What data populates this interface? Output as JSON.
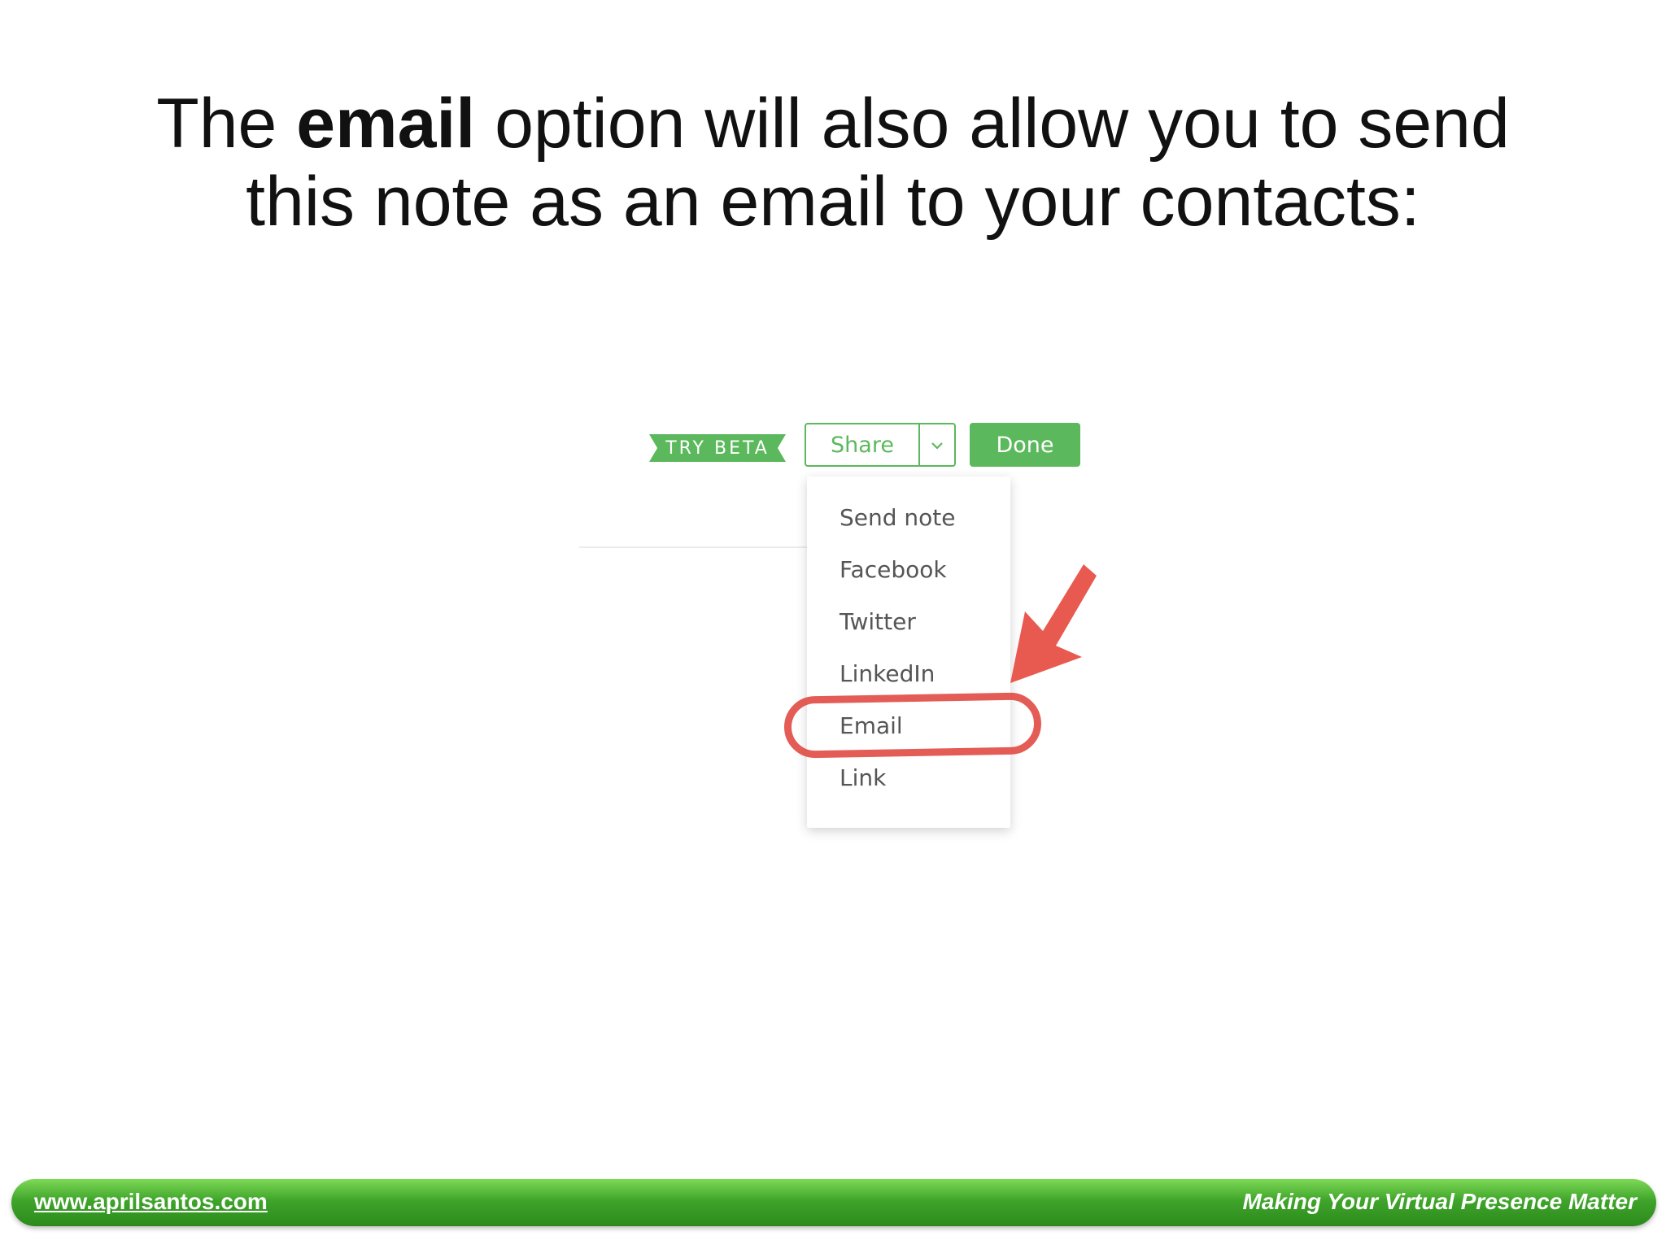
{
  "slide": {
    "title_part1": "The ",
    "title_bold": "email",
    "title_part2": " option will also allow you to send",
    "title_line2": "this note as an email to your contacts:"
  },
  "toolbar": {
    "try_beta_label": "TRY BETA",
    "share_label": "Share",
    "share_toggle": "⌄",
    "done_label": "Done"
  },
  "share_menu": {
    "items": [
      "Send note",
      "Facebook",
      "Twitter",
      "LinkedIn",
      "Email",
      "Link"
    ],
    "highlighted_item": "Email"
  },
  "footer": {
    "website": "www.aprilsantos.com",
    "tagline": "Making Your Virtual Presence Matter"
  },
  "colors": {
    "accent_green": "#5cb85c",
    "annotation_red": "#e0453f",
    "footer_green": "#3fa52a"
  },
  "icons": [
    "chevron-down-icon",
    "red-arrow-icon"
  ]
}
